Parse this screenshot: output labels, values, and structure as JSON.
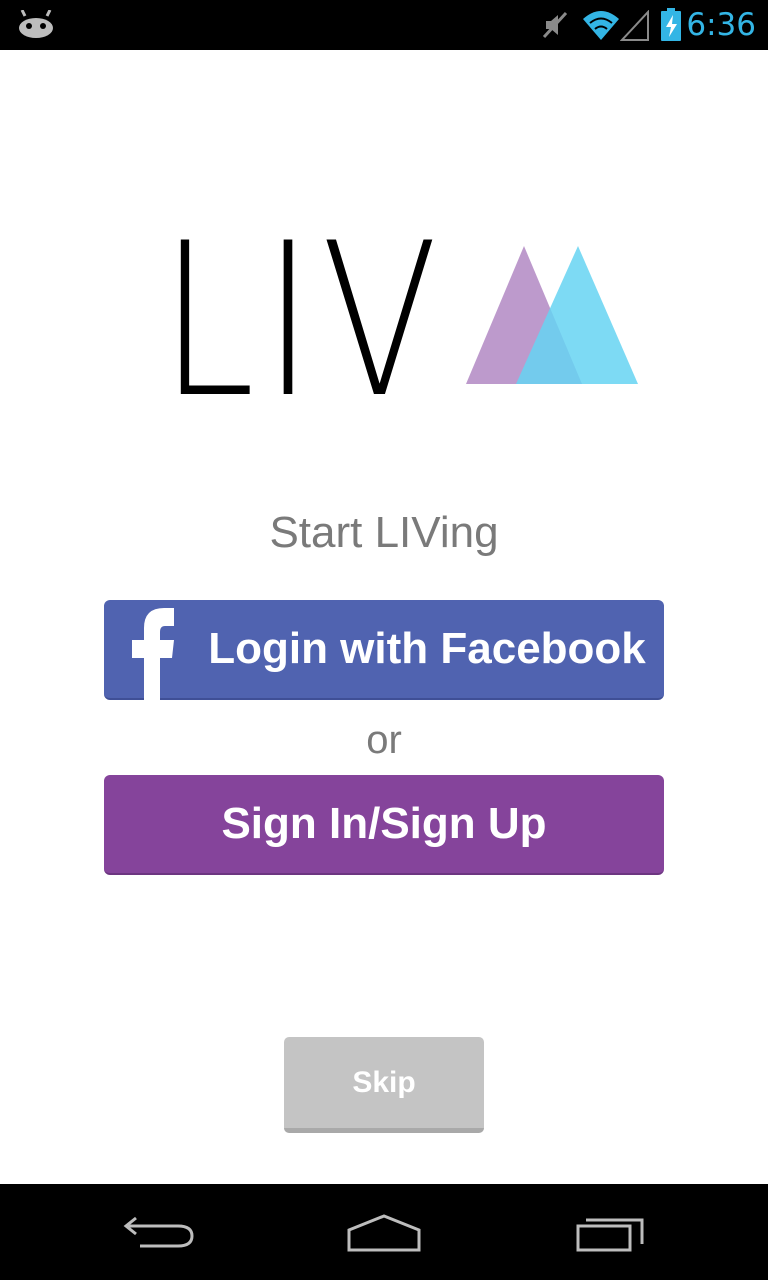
{
  "status_bar": {
    "time": "6:36",
    "icons": [
      "android-icon",
      "mute-icon",
      "wifi-icon",
      "signal-icon",
      "battery-charging-icon"
    ],
    "clock_color": "#33b5e5"
  },
  "logo": {
    "wordmark": "LIV",
    "mark_colors": [
      "#b68fc6",
      "#66d4f2",
      "#57a8de"
    ]
  },
  "tagline": "Start LIVing",
  "facebook_button": {
    "label": "Login with Facebook",
    "icon": "facebook-icon",
    "color": "#5063b0"
  },
  "separator": "or",
  "signin_button": {
    "label": "Sign In/Sign Up",
    "color": "#85449b"
  },
  "skip_button": {
    "label": "Skip",
    "color": "#c4c4c4"
  },
  "nav_bar": {
    "icons": [
      "back-icon",
      "home-icon",
      "recents-icon"
    ]
  }
}
